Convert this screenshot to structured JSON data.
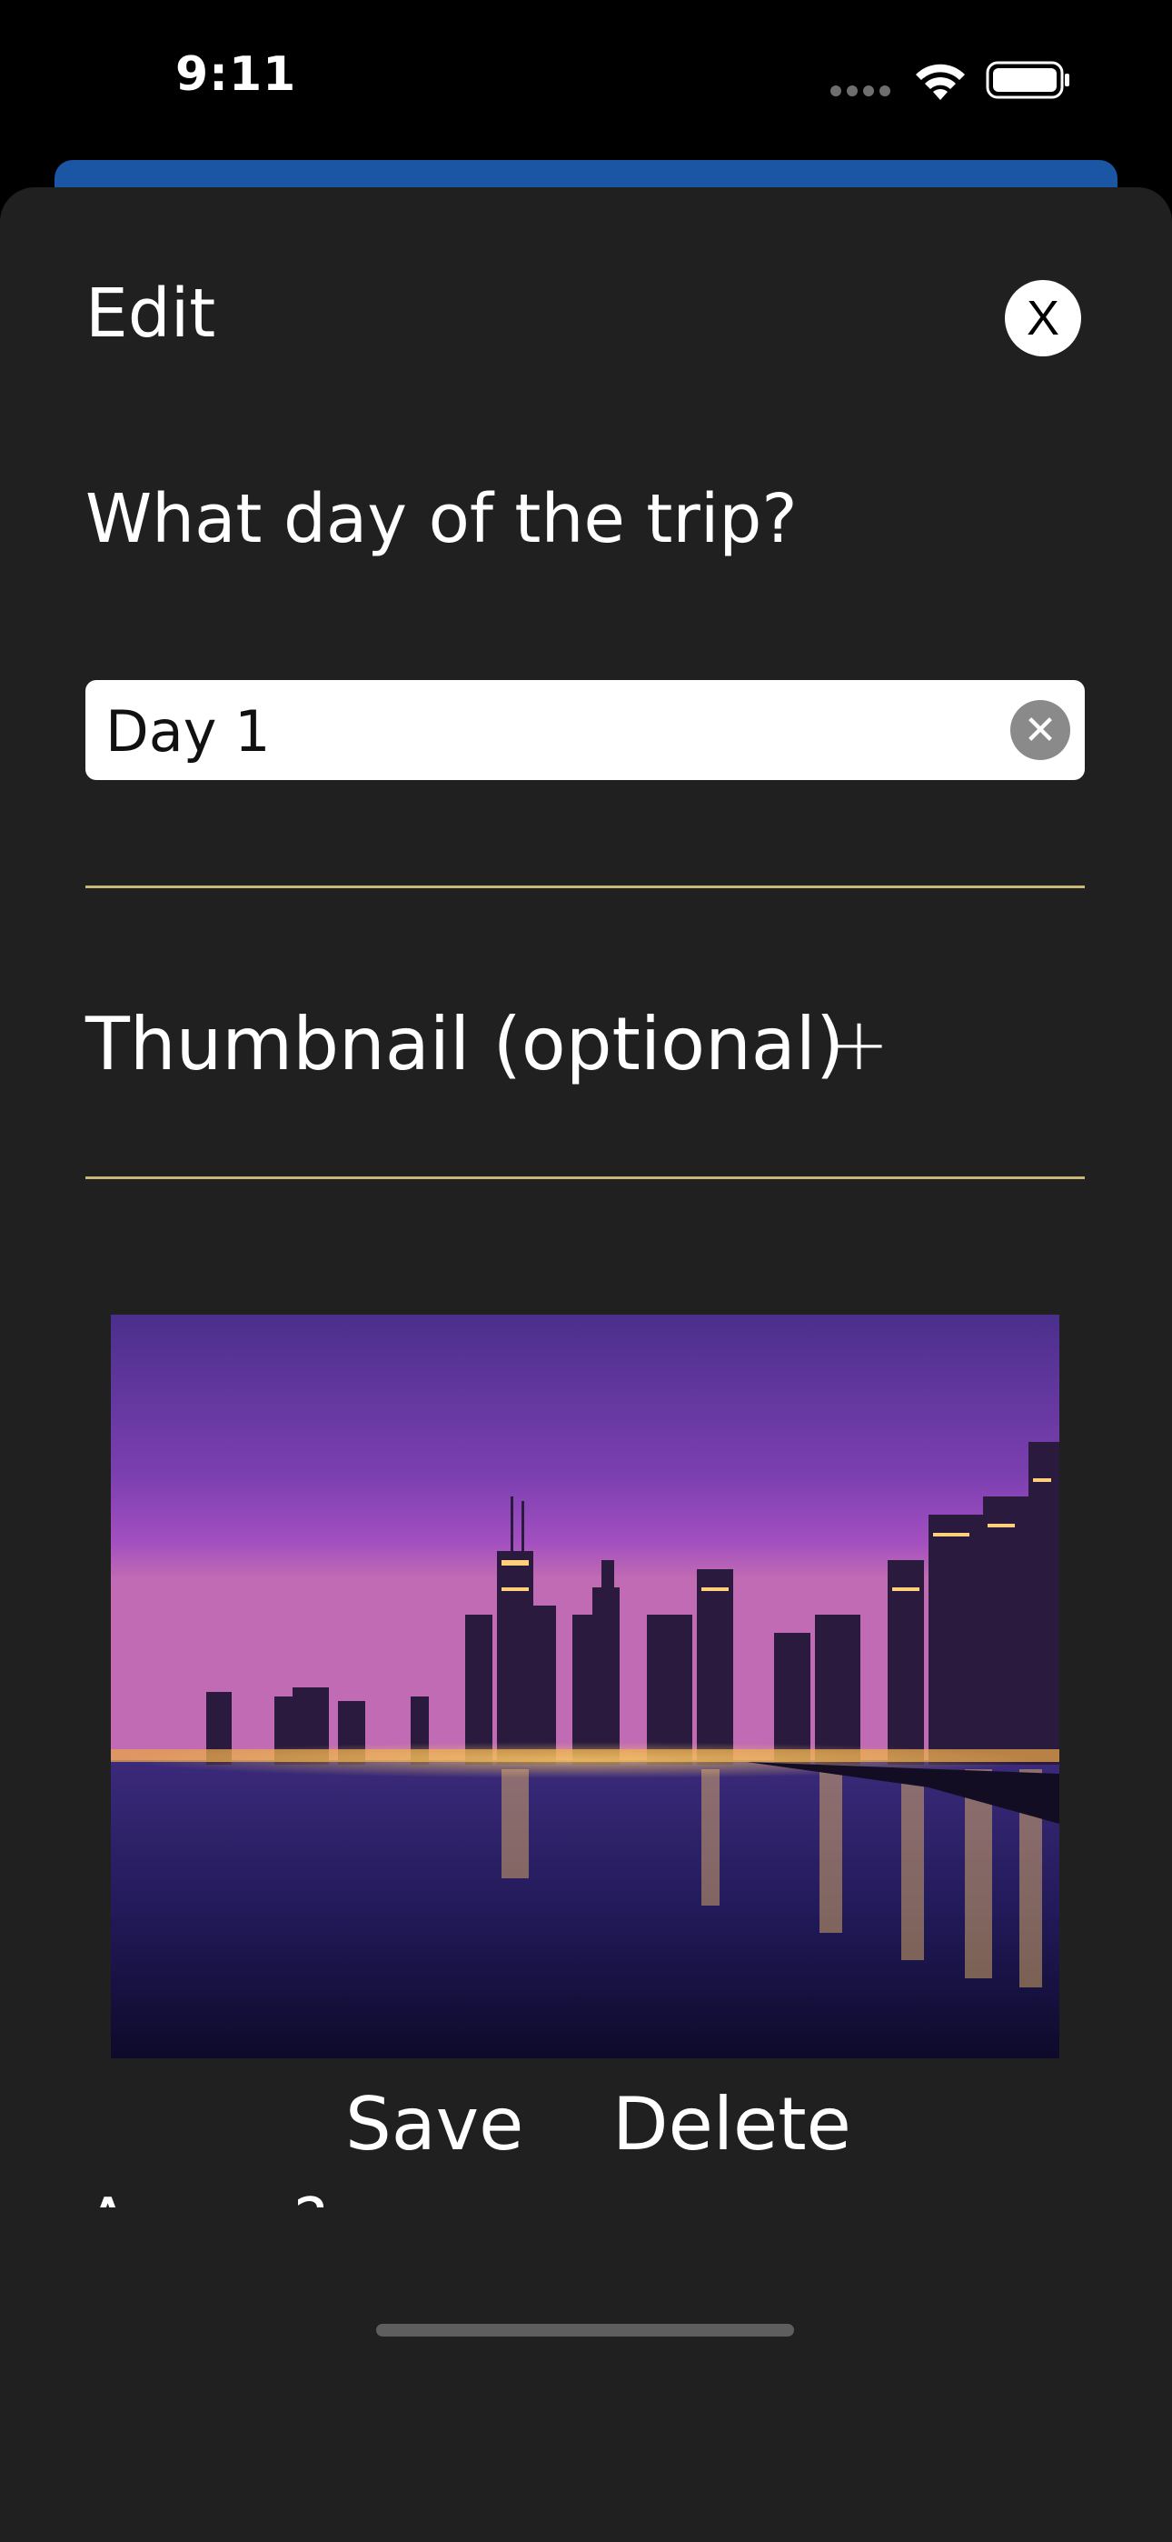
{
  "status_bar": {
    "time": "9:11",
    "icons": [
      "signal-dots-icon",
      "wifi-icon",
      "battery-icon"
    ]
  },
  "sheet": {
    "title": "Edit",
    "close_label": "X",
    "question": "What day of the trip?",
    "day_field": {
      "value": "Day 1",
      "clear_icon": "clear-circle-icon"
    },
    "thumbnail_label": "Thumbnail (optional)",
    "add_thumbnail_label": "+",
    "cut_off_text": "Any n  ?"
  },
  "actions": {
    "save_label": "Save",
    "delete_label": "Delete"
  },
  "colors": {
    "background": "#202020",
    "divider": "#c9b774",
    "behind_card": "#1a56a3"
  }
}
